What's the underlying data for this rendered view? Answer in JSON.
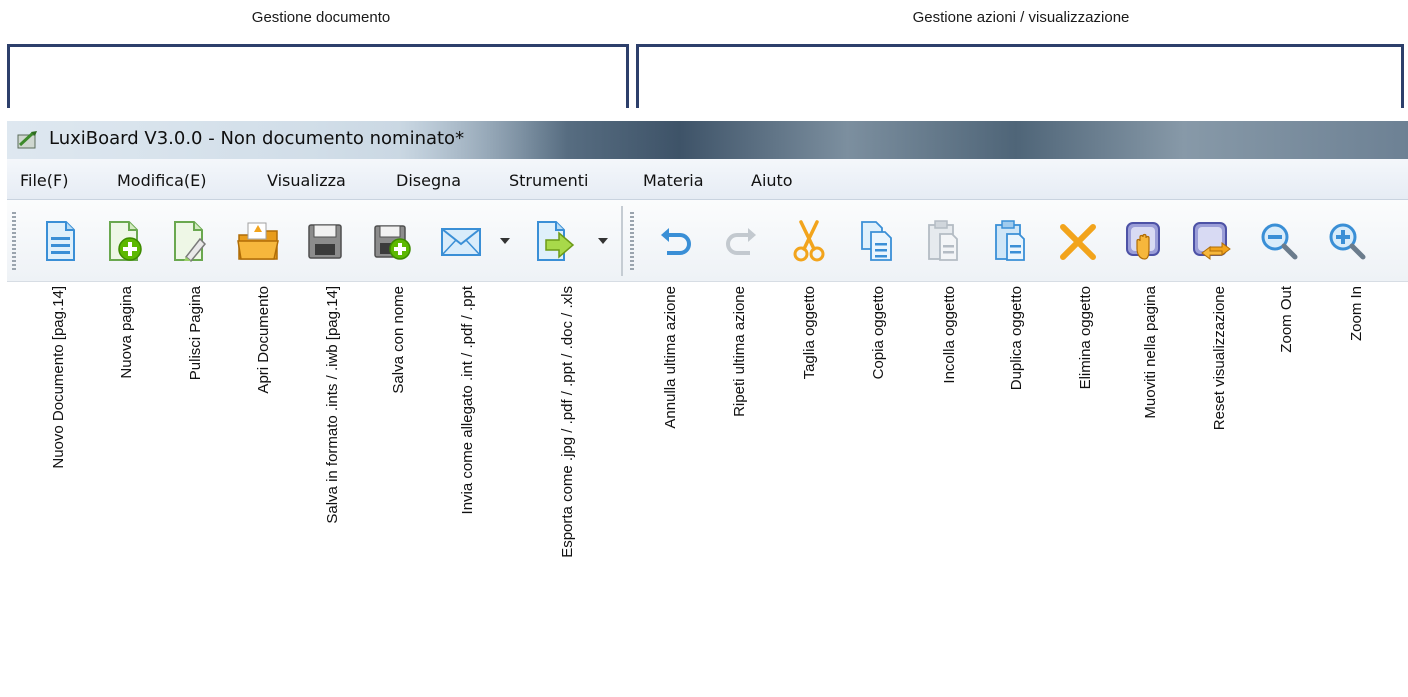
{
  "groups": {
    "document": "Gestione documento",
    "actions": "Gestione azioni / visualizzazione"
  },
  "window": {
    "title": "LuxiBoard V3.0.0 - Non documento nominato*"
  },
  "menu": [
    "File(F)",
    "Modifica(E)",
    "Visualizza",
    "Disegna",
    "Strumenti",
    "Materia",
    "Aiuto"
  ],
  "toolbar": {
    "document_tools": [
      {
        "icon": "new-document-icon",
        "label": "Nuovo Documento [pag.14]"
      },
      {
        "icon": "new-page-icon",
        "label": "Nuova pagina"
      },
      {
        "icon": "clear-page-icon",
        "label": "Pulisci Pagina"
      },
      {
        "icon": "open-folder-icon",
        "label": "Apri Documento"
      },
      {
        "icon": "save-icon",
        "label": "Salva in formato .ints / .iwb [pag.14]"
      },
      {
        "icon": "save-as-icon",
        "label": "Salva con nome"
      },
      {
        "icon": "mail-icon",
        "label": "Invia come allegato .int / .pdf / .ppt"
      },
      {
        "icon": "export-icon",
        "label": "Esporta come .jpg / .pdf /  .ppt / .doc / .xls"
      }
    ],
    "action_tools": [
      {
        "icon": "undo-icon",
        "label": "Annulla ultima azione"
      },
      {
        "icon": "redo-icon",
        "label": "Ripeti ultima azione"
      },
      {
        "icon": "scissors-icon",
        "label": "Taglia oggetto"
      },
      {
        "icon": "copy-icon",
        "label": "Copia oggetto"
      },
      {
        "icon": "paste-icon",
        "label": "Incolla oggetto"
      },
      {
        "icon": "duplicate-icon",
        "label": "Duplica oggetto"
      },
      {
        "icon": "delete-x-icon",
        "label": "Elimina oggetto"
      },
      {
        "icon": "hand-pan-icon",
        "label": "Muoviti nella pagina"
      },
      {
        "icon": "reset-view-icon",
        "label": "Reset visualizzazione"
      },
      {
        "icon": "zoom-out-icon",
        "label": "Zoom Out"
      },
      {
        "icon": "zoom-in-icon",
        "label": "Zoom In"
      }
    ]
  },
  "colors": {
    "bracket": "#2d3f6b",
    "icon_blue": "#3a8fd6",
    "icon_green": "#5cb800",
    "icon_orange": "#f2a41c"
  }
}
